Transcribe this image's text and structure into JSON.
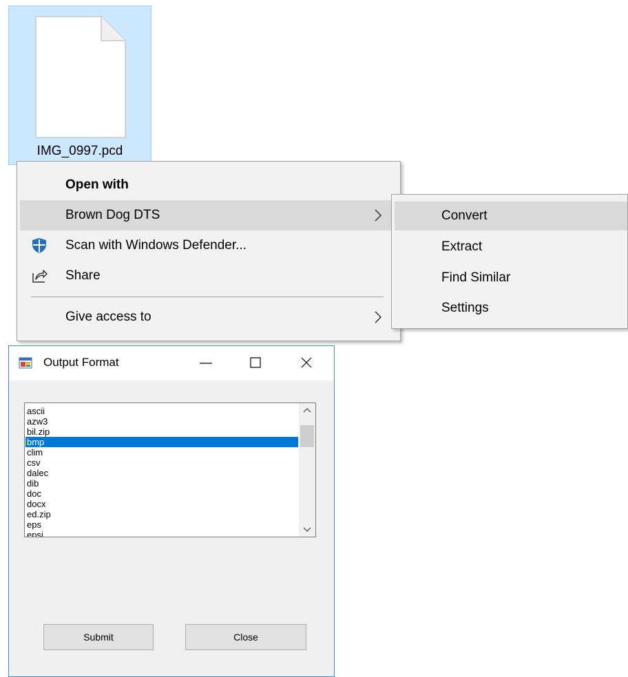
{
  "file": {
    "name": "IMG_0997.pcd",
    "icon": "blank-file-icon"
  },
  "context_menu": {
    "items": [
      {
        "label": "Open with",
        "bold": true
      },
      {
        "label": "Brown Dog DTS",
        "has_submenu": true,
        "hover": true
      },
      {
        "label": "Scan with Windows Defender...",
        "icon": "windows-defender-shield-icon"
      },
      {
        "label": "Share",
        "icon": "share-icon"
      },
      {
        "label": "Give access to",
        "has_submenu": true
      }
    ]
  },
  "submenu": {
    "items": [
      {
        "label": "Convert",
        "hover": true
      },
      {
        "label": "Extract"
      },
      {
        "label": "Find Similar"
      },
      {
        "label": "Settings"
      }
    ]
  },
  "dialog": {
    "title": "Output Format",
    "formats": [
      "ascii",
      "azw3",
      "bil.zip",
      "bmp",
      "clim",
      "csv",
      "dalec",
      "dib",
      "doc",
      "docx",
      "ed.zip",
      "eps",
      "epsi"
    ],
    "selected": "bmp",
    "submit_label": "Submit",
    "close_label": "Close"
  },
  "colors": {
    "selection": "#0078d7",
    "file_tile": "#cce8ff",
    "menu_hover": "#d9d9d9",
    "dialog_border": "#3c8fd6"
  }
}
